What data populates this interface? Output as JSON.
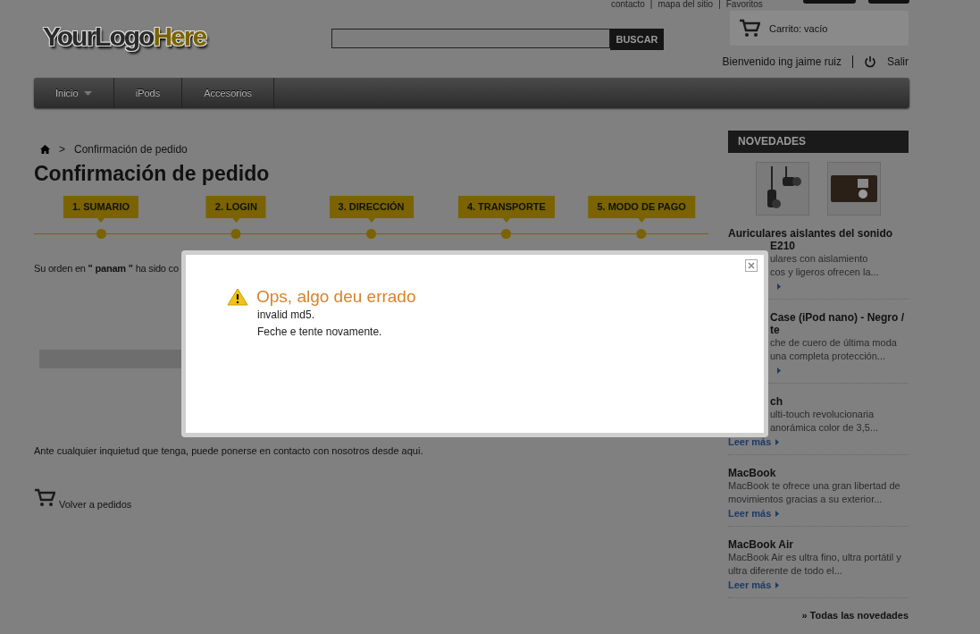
{
  "top_links": [
    {
      "text": "contacto",
      "separator": "|"
    },
    {
      "text": "mapa del sitio",
      "separator": "|"
    },
    {
      "text": "Favoritos"
    }
  ],
  "logo": {
    "first": "YourLogo",
    "second": "Here"
  },
  "search": {
    "button": "BUSCAR"
  },
  "cart": {
    "label": "Carrito: vacío"
  },
  "user": {
    "welcome": "Bienvenido ing jaime ruiz",
    "logout": "Salir"
  },
  "nav": [
    {
      "label": "Inicio",
      "has_menu": true
    },
    {
      "label": "iPods",
      "has_menu": false
    },
    {
      "label": "Accesorios",
      "has_menu": false
    }
  ],
  "breadcrumb": {
    "separator": ">",
    "current": "Confirmación de pedido"
  },
  "page_title": "Confirmación de pedido",
  "steps": [
    {
      "label": "1. SUMARIO"
    },
    {
      "label": "2. LOGIN"
    },
    {
      "label": "3. DIRECCIÓN"
    },
    {
      "label": "4. TRANSPORTE"
    },
    {
      "label": "5. MODO DE PAGO"
    }
  ],
  "order_message": "Su orden en **\" panam \"** ha sido co",
  "contact_message": "Ante cualquier inquietud que tenga, puede ponerse en contacto con nosotros desde aqui.",
  "back_link": "Volver a pedidos",
  "sidebar": {
    "heading": "NOVEDADES",
    "more_link": "» Todas las novedades",
    "items": [
      {
        "title_lines": [
          {
            "text": "Auriculares aislantes del sonido",
            "kind": "whole"
          },
          {
            "text": "E210",
            "kind": "cut"
          }
        ],
        "text_lines": [
          {
            "text": "ulares con aislamiento",
            "kind": "cut"
          },
          {
            "text": "cos y ligeros ofrecen la...",
            "kind": "cut"
          }
        ],
        "link": {
          "kind": "cut"
        }
      },
      {
        "title_lines": [
          {
            "text": "Case (iPod nano) - Negro /",
            "kind": "cut"
          },
          {
            "text": "te",
            "kind": "cut"
          }
        ],
        "text_lines": [
          {
            "text": "che de cuero de última moda",
            "kind": "cut"
          },
          {
            "text": "una completa protección...",
            "kind": "cut"
          }
        ],
        "link": {
          "kind": "cut"
        }
      },
      {
        "title_lines": [
          {
            "text": "ch",
            "kind": "cut"
          }
        ],
        "text_lines": [
          {
            "text": "ulti-touch revolucionaria",
            "kind": "cut"
          },
          {
            "text": "anorámica color de 3,5...",
            "kind": "cut"
          }
        ],
        "link": {
          "kind": "whole",
          "text": "Leer más"
        }
      },
      {
        "title_lines": [
          {
            "text": "MacBook",
            "kind": "whole"
          }
        ],
        "text_lines": [
          {
            "text": "MacBook te ofrece una gran libertad de",
            "kind": "whole"
          },
          {
            "text": "movimientos gracias a su exterior...",
            "kind": "whole"
          }
        ],
        "link": {
          "kind": "whole",
          "text": "Leer más"
        }
      },
      {
        "title_lines": [
          {
            "text": "MacBook Air",
            "kind": "whole"
          }
        ],
        "text_lines": [
          {
            "text": "MacBook Air es ultra fino, ultra portátil y",
            "kind": "whole"
          },
          {
            "text": "ultra diferente de todo el...",
            "kind": "whole"
          }
        ],
        "link": {
          "kind": "whole",
          "text": "Leer más"
        }
      }
    ]
  },
  "modal": {
    "title": "Ops, algo deu errado",
    "lines": [
      "invalid md5.",
      "Feche e tente novamente."
    ]
  }
}
